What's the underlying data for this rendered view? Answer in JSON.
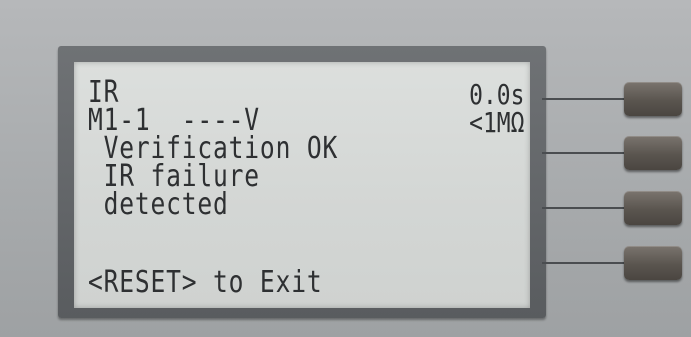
{
  "display": {
    "row1_left": "IR",
    "row1_right": "0.0s",
    "row2_left": "M1-1  ----V",
    "row2_right": "<1MΩ",
    "message_line1": " Verification OK",
    "message_line2": " IR failure",
    "message_line3": " detected",
    "footer": "<RESET> to Exit"
  },
  "softkeys": [
    {
      "name": "softkey-1"
    },
    {
      "name": "softkey-2"
    },
    {
      "name": "softkey-3"
    },
    {
      "name": "softkey-4"
    }
  ]
}
